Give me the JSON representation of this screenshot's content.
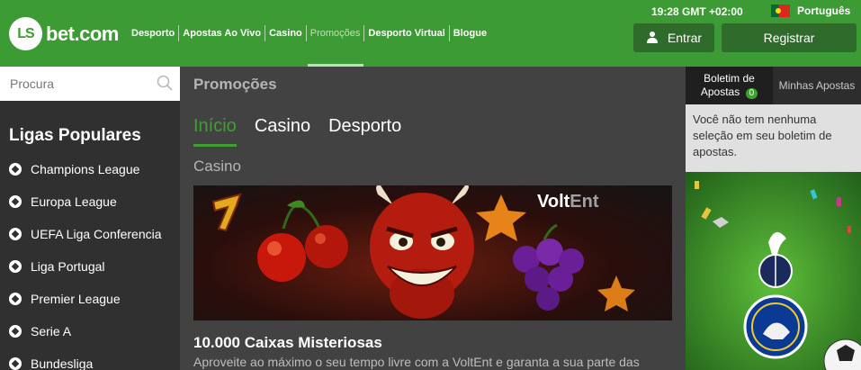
{
  "header": {
    "logo_badge": "LS",
    "logo_text": "bet.com",
    "nav": [
      {
        "label": "Desporto",
        "active": false
      },
      {
        "label": "Apostas Ao Vivo",
        "active": false
      },
      {
        "label": "Casino",
        "active": false
      },
      {
        "label": "Promoções",
        "active": true
      },
      {
        "label": "Desporto Virtual",
        "active": false
      },
      {
        "label": "Blogue",
        "active": false
      }
    ],
    "clock": "19:28 GMT +02:00",
    "language": "Português",
    "login_label": "Entrar",
    "register_label": "Registrar"
  },
  "sidebar": {
    "search_placeholder": "Procura",
    "title": "Ligas Populares",
    "leagues": [
      "Champions League",
      "Europa League",
      "UEFA Liga Conferencia",
      "Liga Portugal",
      "Premier League",
      "Serie A",
      "Bundesliga"
    ]
  },
  "main": {
    "title": "Promoções",
    "tabs": [
      {
        "label": "Início",
        "active": true
      },
      {
        "label": "Casino",
        "active": false
      },
      {
        "label": "Desporto",
        "active": false
      }
    ],
    "section": "Casino",
    "banner_provider_a": "Volt",
    "banner_provider_b": "Ent",
    "promo_title": "10.000 Caixas Misteriosas",
    "promo_desc": "Aproveite ao máximo o seu tempo livre com a VoltEnt e garanta a sua parte das"
  },
  "betslip": {
    "tab_betslip_line1": "Boletim de",
    "tab_betslip_line2": "Apostas",
    "betslip_count": "0",
    "tab_mybets": "Minhas Apostas",
    "empty_message": "Você não tem nenhuma seleção em seu boletim de apostas."
  },
  "colors": {
    "brand_green": "#3d9b35",
    "dark_green_button": "#2f6b2a",
    "active_tab_green": "#3da031"
  }
}
